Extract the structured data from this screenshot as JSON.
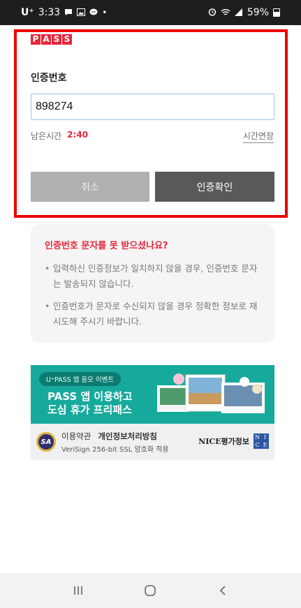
{
  "status_bar": {
    "carrier": "U⁺",
    "time": "3:33",
    "left_icons": [
      "chat-icon",
      "gallery-icon",
      "message-icon",
      "dot-icon"
    ],
    "right_icons": [
      "alarm-icon",
      "wifi-icon",
      "signal-icon",
      "battery-icon"
    ],
    "battery": "59%"
  },
  "logo": {
    "letters": [
      "P",
      "A",
      "S",
      "S"
    ],
    "color": "#e8263b"
  },
  "form": {
    "label": "인증번호",
    "code_value": "898274",
    "remaining_label": "남은시간",
    "remaining_time": "2:40",
    "extend_label": "시간연장",
    "cancel_label": "취소",
    "confirm_label": "인증확인"
  },
  "info": {
    "title": "인증번호 문자를 못 받으셨나요?",
    "items": [
      "입력하신 인증정보가 일치하지 않을 경우, 인증번호 문자는 발송되지 않습니다.",
      "인증번호가 문자로 수신되지 않을 경우 정확한 정보로 재시도해 주시기 바랍니다."
    ]
  },
  "banner": {
    "tag": "U⁺PASS 앱 응모 이벤트",
    "title_line1": "PASS 앱 이용하고",
    "title_line2": "도심 휴가 프리패스"
  },
  "footer": {
    "seal": "SA",
    "terms_label": "이용약관",
    "privacy_label": "개인정보처리방침",
    "ssl_text": "VeriSign 256-bit SSL 암호화 적용",
    "nice_text": "NICE평가정보",
    "nice_badge": [
      "N",
      "I",
      "C",
      "E"
    ]
  },
  "colors": {
    "accent": "#e8263b",
    "highlight_border": "#ee0000",
    "banner_bg": "#17aa9c",
    "confirm_bg": "#595959",
    "cancel_bg": "#b0b0b0"
  },
  "nav": {
    "icons": [
      "recent-apps-icon",
      "home-icon",
      "back-icon"
    ]
  }
}
